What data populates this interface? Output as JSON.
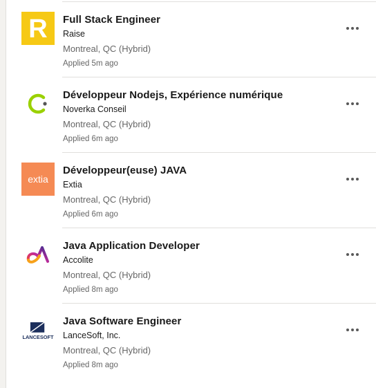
{
  "jobs": [
    {
      "title": "Full Stack Engineer",
      "company": "Raise",
      "location": "Montreal, QC (Hybrid)",
      "applied": "Applied 5m ago",
      "logo_text": "R",
      "logo_bg": "#f6c915",
      "logo_fg": "#ffffff"
    },
    {
      "title": "Développeur Nodejs, Expérience numérique",
      "company": "Noverka Conseil",
      "location": "Montreal, QC (Hybrid)",
      "applied": "Applied 6m ago",
      "logo_fg": "#9ad100",
      "logo_dot": "#555555"
    },
    {
      "title": "Développeur(euse) JAVA",
      "company": "Extia",
      "location": "Montreal, QC (Hybrid)",
      "applied": "Applied 6m ago",
      "logo_text": "extia",
      "logo_bg": "#f58a54",
      "logo_fg": "#ffffff"
    },
    {
      "title": "Java Application Developer",
      "company": "Accolite",
      "location": "Montreal, QC (Hybrid)",
      "applied": "Applied 8m ago"
    },
    {
      "title": "Java Software Engineer",
      "company": "LanceSoft, Inc.",
      "location": "Montreal, QC (Hybrid)",
      "applied": "Applied 8m ago",
      "logo_text": "LANCESOFT",
      "logo_fg": "#1c2f5c"
    }
  ],
  "icons": {
    "more": "more-options-icon"
  }
}
